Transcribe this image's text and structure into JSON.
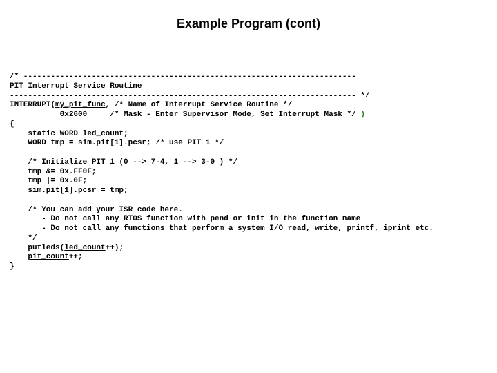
{
  "title": "Example Program (cont)",
  "code": {
    "l01": "/* -------------------------------------------------------------------------",
    "l02": "PIT Interrupt Service Routine",
    "l03": "---------------------------------------------------------------------------- */",
    "l04a": "INTERRUPT(",
    "l04b": "my_pit_func",
    "l04c": ", /* Name of Interrupt Service Routine */",
    "l05a": "           ",
    "l05b": "0x2600",
    "l05c": "     /* Mask - Enter Supervisor Mode, Set Interrupt Mask */ ",
    "l05d": ")",
    "l06": "{",
    "l07": "    static WORD led_count;",
    "l08": "    WORD tmp = sim.pit[1].pcsr; /* use PIT 1 */",
    "l09": "",
    "l10": "    /* Initialize PIT 1 (0 --> 7-4, 1 --> 3-0 ) */",
    "l11": "    tmp &= 0x.FF0F;",
    "l12": "    tmp |= 0x.0F;",
    "l13": "    sim.pit[1].pcsr = tmp;",
    "l14": "",
    "l15": "    /* You can add your ISR code here.",
    "l16": "       - Do not call any RTOS function with pend or init in the function name",
    "l17": "       - Do not call any functions that perform a system I/O read, write, printf, iprint etc.",
    "l18": "    */",
    "l19a": "    putleds(",
    "l19b": "led_count",
    "l19c": "++);",
    "l20a": "    ",
    "l20b": "pit_count",
    "l20c": "++;",
    "l21": "}"
  }
}
